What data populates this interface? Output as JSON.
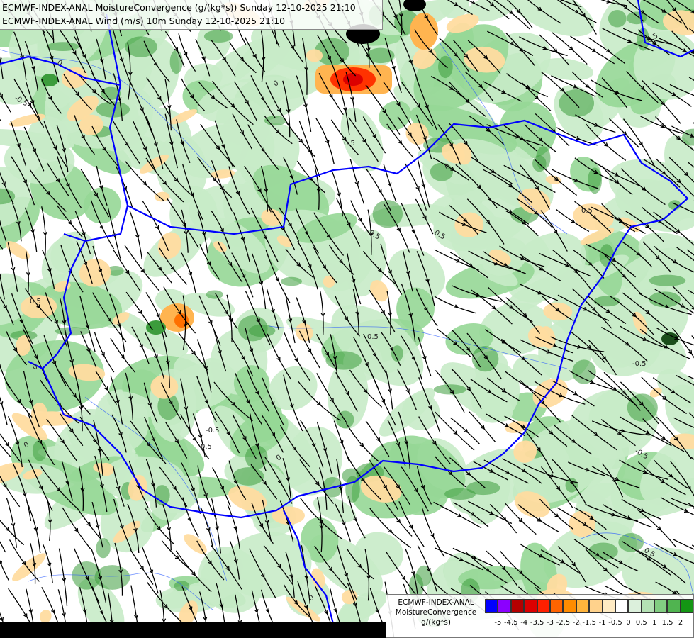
{
  "header": {
    "line1": "ECMWF-INDEX-ANAL MoistureConvergence (g/(kg*s)) Sunday 12-10-2025 21:10",
    "line2": "ECMWF-INDEX-ANAL Wind (m/s) 10m Sunday 12-10-2025 21:10"
  },
  "legend": {
    "line1": "ECMWF-INDEX-ANAL",
    "line2": "MoistureConvergence",
    "line3": "g/(kg*s)",
    "colors": [
      "#0000ff",
      "#8b00ff",
      "#b40000",
      "#dc0000",
      "#ff2000",
      "#ff6400",
      "#ff8c00",
      "#ffb43c",
      "#ffd28c",
      "#ffebc3",
      "#ffffff",
      "#dcf0dc",
      "#b4e1b4",
      "#82cd82",
      "#50b450",
      "#149614"
    ],
    "tick_labels": [
      "-5",
      "-4.5",
      "-4",
      "-3.5",
      "-3",
      "-2.5",
      "-2",
      "-1.5",
      "-1",
      "-0.5",
      "0",
      "0.5",
      "1",
      "1.5",
      "2"
    ]
  },
  "contour_labels": [
    "0",
    "0.5",
    "-0.5",
    "0",
    "0.5",
    "0.5",
    "0",
    "-0.5",
    "0.5",
    "0",
    "0.5",
    "0.5",
    "0",
    "0.5",
    "-0.5",
    "0",
    "0.5",
    "0",
    "0.5",
    "-0.5"
  ],
  "palette": {
    "border": "#0000ff",
    "river": "#2a5aff",
    "streamline": "#000000",
    "green_light": "#c8ebc8",
    "green_mid": "#96d796",
    "green_dark": "#3c9c3c",
    "orange_light": "#ffdca0",
    "orange_mid": "#ffb450",
    "red": "#ff3200"
  }
}
